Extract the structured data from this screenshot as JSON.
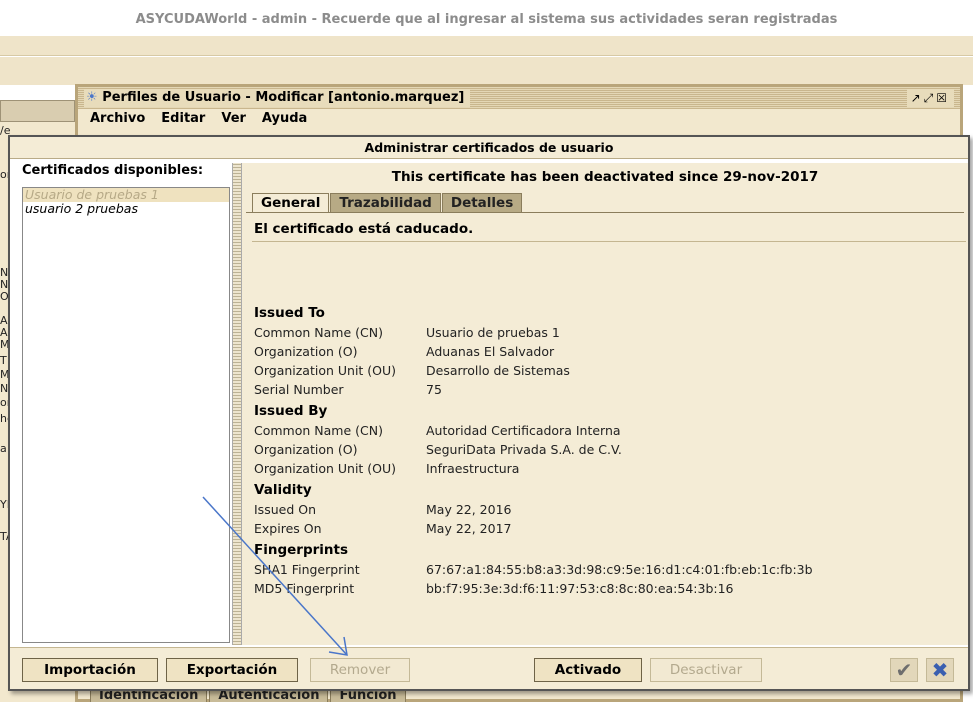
{
  "app": {
    "title": "ASYCUDAWorld - admin - Recuerde que al ingresar al sistema sus actividades seran registradas"
  },
  "background_fragments": [
    "/e",
    "or",
    "N",
    "N",
    "O",
    "A",
    "A",
    "M",
    "T",
    "M",
    "N",
    "or",
    "he",
    "a",
    "YI",
    "TA"
  ],
  "inner_window": {
    "title": "Perfiles de Usuario - Modificar [antonio.marquez]",
    "controls": "↗⤢☒",
    "menu": [
      "Archivo",
      "Editar",
      "Ver",
      "Ayuda"
    ],
    "bottom_tabs": [
      "Identificación",
      "Autenticación",
      "Función"
    ]
  },
  "dialog": {
    "title": "Administrar certificados de usuario",
    "list_label": "Certificados disponibles:",
    "certificates": [
      {
        "name": "Usuario de pruebas 1",
        "selected": true
      },
      {
        "name": "usuario 2 pruebas",
        "selected": false
      }
    ],
    "deactivated_notice": "This certificate has been deactivated since 29-nov-2017",
    "tabs": [
      {
        "label": "General",
        "active": true
      },
      {
        "label": "Trazabilidad",
        "active": false
      },
      {
        "label": "Detalles",
        "active": false
      }
    ],
    "status": "El certificado está caducado.",
    "issued_to": {
      "heading": "Issued To",
      "rows": [
        {
          "k": "Common Name (CN)",
          "v": "Usuario de pruebas 1"
        },
        {
          "k": "Organization (O)",
          "v": "Aduanas El Salvador"
        },
        {
          "k": "Organization Unit (OU)",
          "v": "Desarrollo de Sistemas"
        },
        {
          "k": "Serial Number",
          "v": "75"
        }
      ]
    },
    "issued_by": {
      "heading": "Issued By",
      "rows": [
        {
          "k": "Common Name (CN)",
          "v": "Autoridad Certificadora Interna"
        },
        {
          "k": "Organization (O)",
          "v": "SeguriData Privada S.A. de C.V."
        },
        {
          "k": "Organization Unit (OU)",
          "v": "Infraestructura"
        }
      ]
    },
    "validity": {
      "heading": "Validity",
      "rows": [
        {
          "k": "Issued On",
          "v": "May 22, 2016"
        },
        {
          "k": "Expires On",
          "v": "May 22, 2017"
        }
      ]
    },
    "fingerprints": {
      "heading": "Fingerprints",
      "rows": [
        {
          "k": "SHA1 Fingerprint",
          "v": "67:67:a1:84:55:b8:a3:3d:98:c9:5e:16:d1:c4:01:fb:eb:1c:fb:3b"
        },
        {
          "k": "MD5 Fingerprint",
          "v": "bb:f7:95:3e:3d:f6:11:97:53:c8:8c:80:ea:54:3b:16"
        }
      ]
    },
    "buttons": {
      "import": "Importación",
      "export": "Exportación",
      "remove": "Remover",
      "activated": "Activado",
      "deactivate": "Desactivar"
    },
    "icons": {
      "ok": "checkmark-icon",
      "cancel": "close-icon"
    },
    "colors": {
      "accent": "#3a5fb0",
      "panel": "#f4ecd6",
      "annotation_arrow": "#4a76c9"
    }
  }
}
